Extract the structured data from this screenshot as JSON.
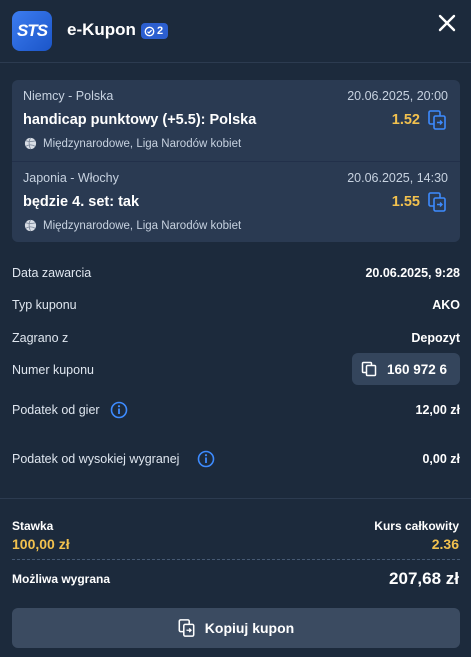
{
  "header": {
    "logo_text": "STS",
    "title": "e-Kupon",
    "badge_count": "2",
    "badge_icon": "bet-count-icon",
    "close_icon": "close-icon"
  },
  "bets": [
    {
      "match": "Niemcy - Polska",
      "datetime": "20.06.2025, 20:00",
      "pick": "handicap punktowy (+5.5): Polska",
      "odds": "1.52",
      "league": "Międzynarodowe, Liga Narodów kobiet"
    },
    {
      "match": "Japonia - Włochy",
      "datetime": "20.06.2025, 14:30",
      "pick": "będzie 4. set: tak",
      "odds": "1.55",
      "league": "Międzynarodowe, Liga Narodów kobiet"
    }
  ],
  "details": {
    "date_label": "Data zawarcia",
    "date_value": "20.06.2025, 9:28",
    "type_label": "Typ kuponu",
    "type_value": "AKO",
    "source_label": "Zagrano z",
    "source_value": "Depozyt",
    "number_label": "Numer kuponu",
    "number_value": "160 972 6",
    "tax_label": "Podatek od gier",
    "tax_value": "12,00 zł",
    "hightax_label": "Podatek od wysokiej wygranej",
    "hightax_value": "0,00 zł"
  },
  "summary": {
    "stake_label": "Stawka",
    "stake_value": "100,00 zł",
    "total_odds_label": "Kurs całkowity",
    "total_odds_value": "2.36",
    "win_label": "Możliwa wygrana",
    "win_value": "207,68 zł"
  },
  "actions": {
    "copy_label": "Kopiuj kupon"
  },
  "colors": {
    "background": "#1c2a3c",
    "panel": "#2a3a52",
    "accent_gold": "#f2c14e",
    "accent_blue": "#2c5fd0",
    "button": "#3b4b61"
  }
}
